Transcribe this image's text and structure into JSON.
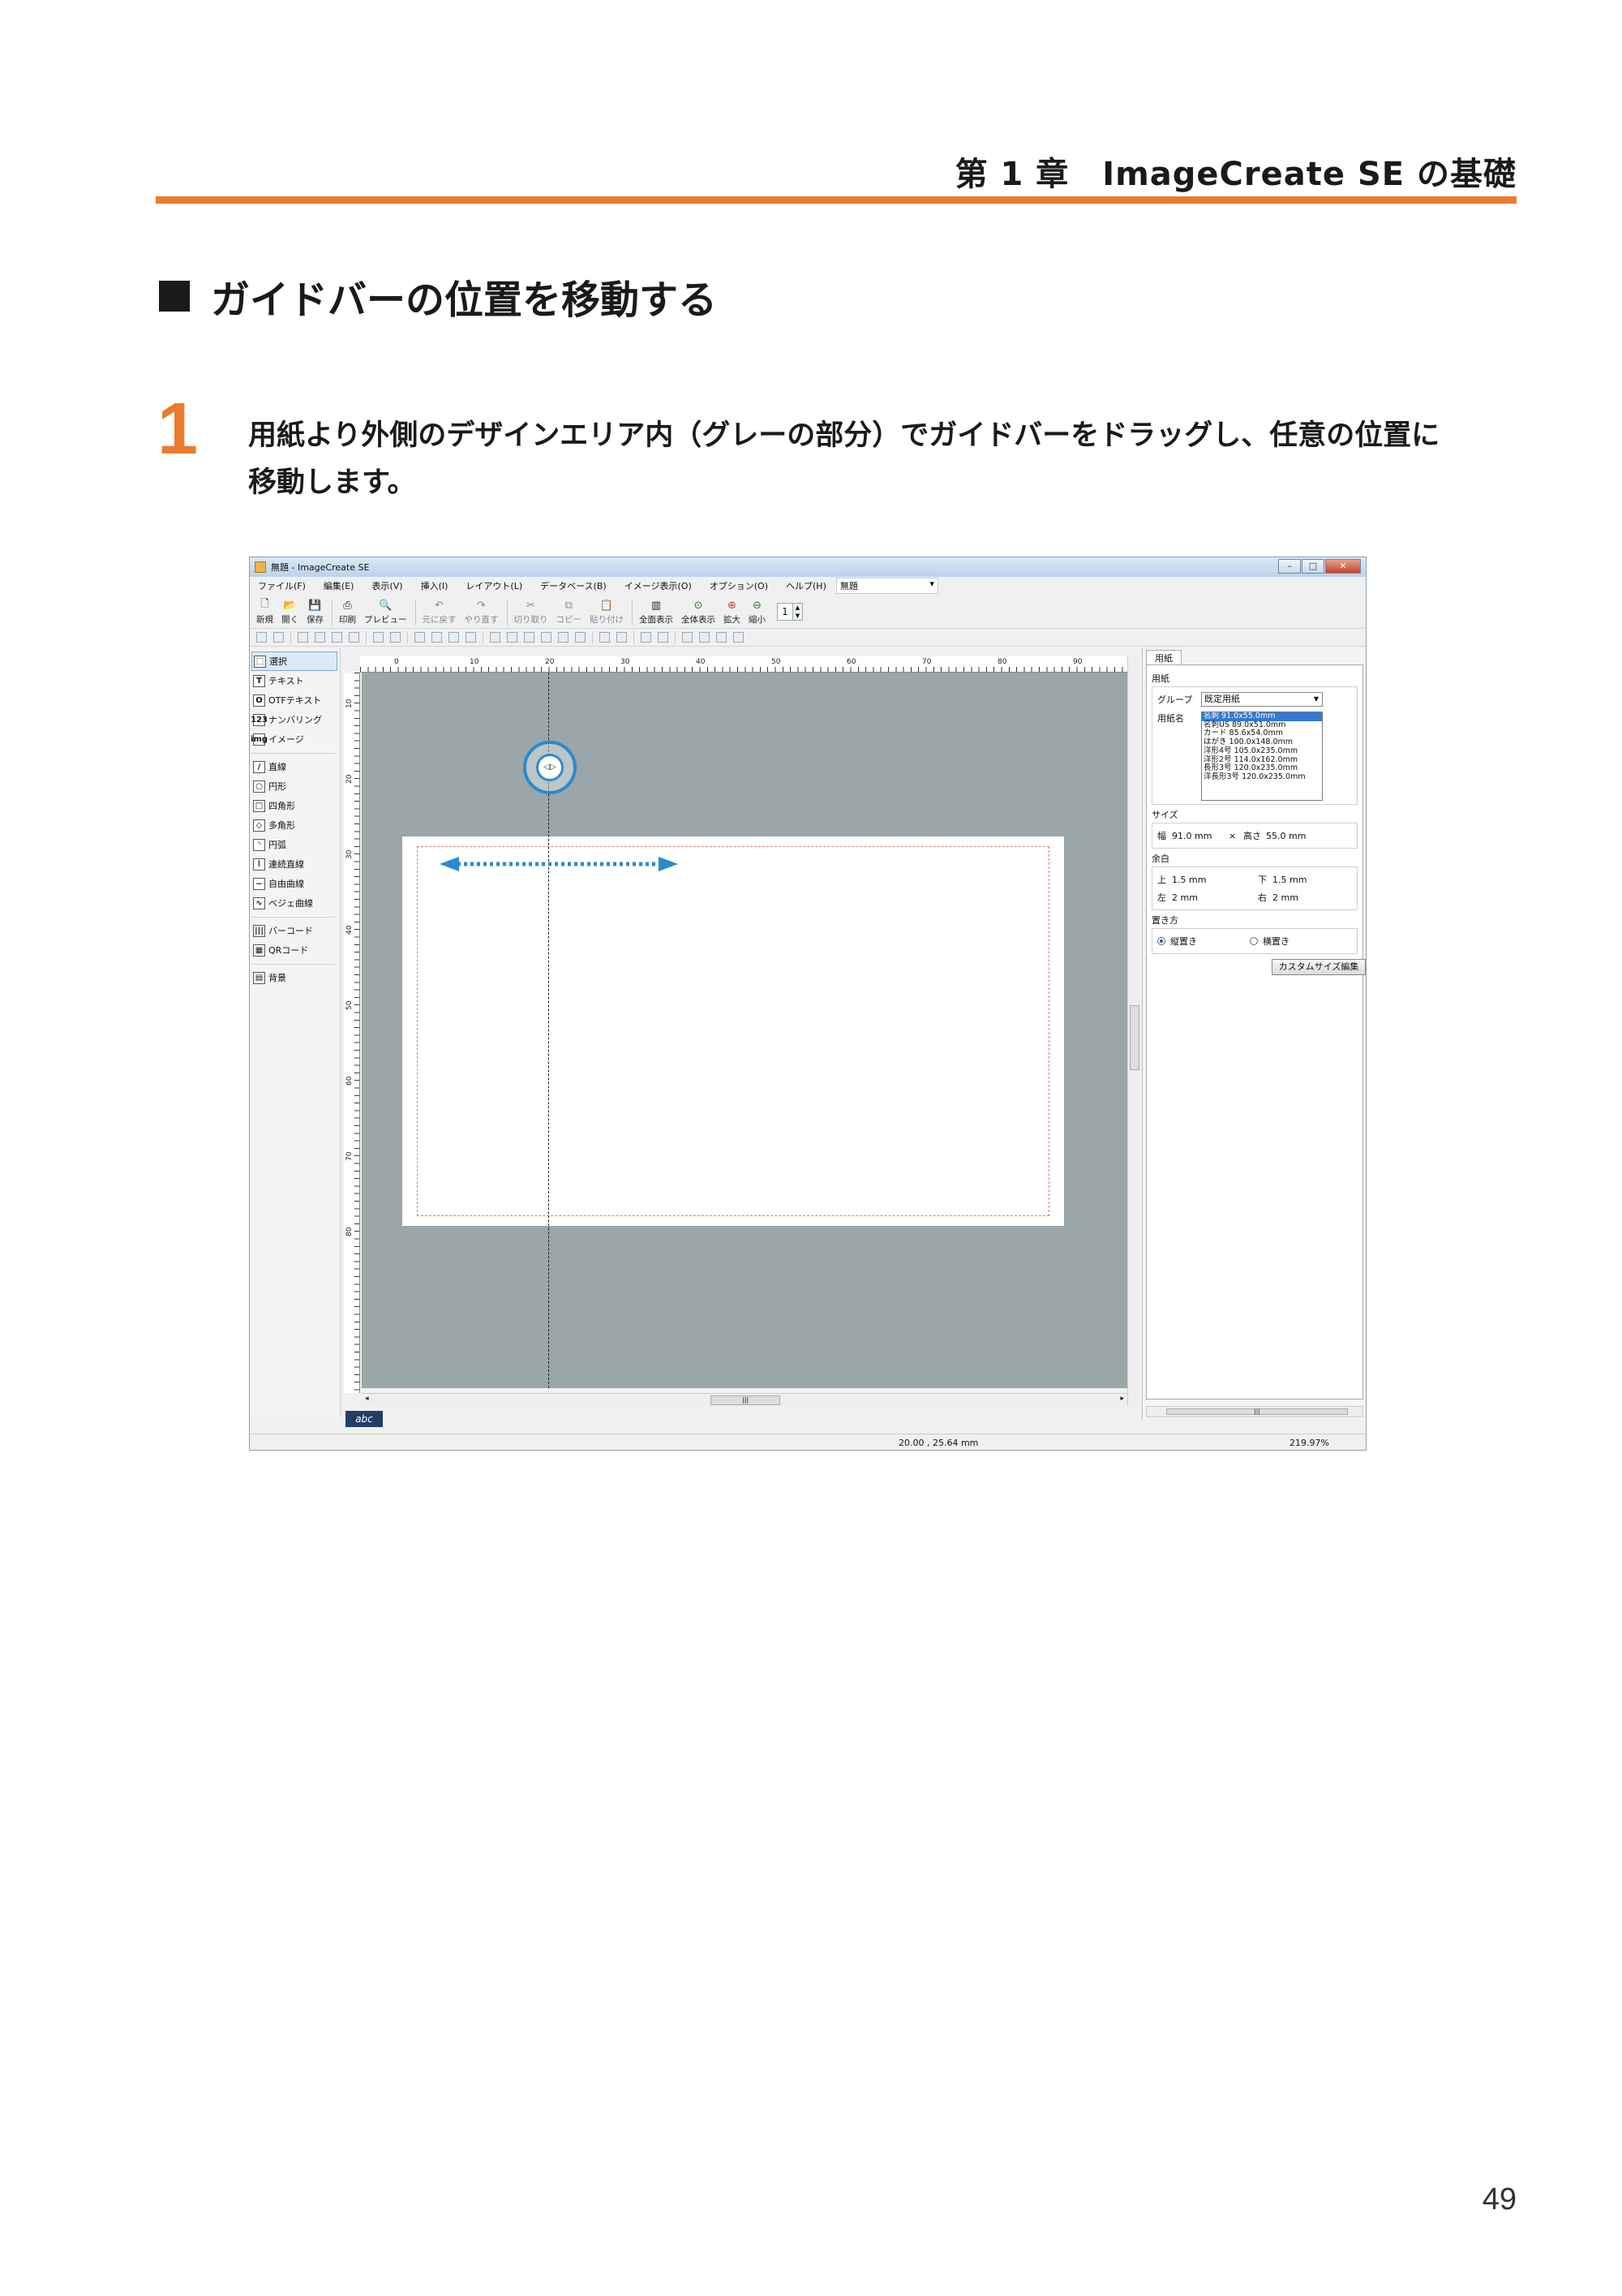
{
  "page": {
    "chapter_header": "第 1 章　ImageCreate SE の基礎",
    "section_title": "ガイドバーの位置を移動する",
    "step_number": "1",
    "step_text_line1": "用紙より外側のデザインエリア内（グレーの部分）でガイドバーをドラッグし、任意の位置に",
    "step_text_line2": "移動します。",
    "page_number": "49",
    "accent_color": "#ec7a2e"
  },
  "app": {
    "title": "無題 - ImageCreate SE",
    "menu": [
      "ファイル(F)",
      "編集(E)",
      "表示(V)",
      "挿入(I)",
      "レイアウト(L)",
      "データベース(B)",
      "イメージ表示(O)",
      "オプション(O)",
      "ヘルプ(H)"
    ],
    "document_select": "無題",
    "toolbar": [
      {
        "label": "新規",
        "icon": "new-document-icon"
      },
      {
        "label": "開く",
        "icon": "open-folder-icon"
      },
      {
        "label": "保存",
        "icon": "save-icon"
      },
      {
        "label": "印刷",
        "icon": "print-icon"
      },
      {
        "label": "プレビュー",
        "icon": "preview-icon"
      },
      {
        "label": "元に戻す",
        "icon": "undo-icon"
      },
      {
        "label": "やり直す",
        "icon": "redo-icon"
      },
      {
        "label": "切り取り",
        "icon": "cut-icon"
      },
      {
        "label": "コピー",
        "icon": "copy-icon"
      },
      {
        "label": "貼り付け",
        "icon": "paste-icon"
      },
      {
        "label": "全面表示",
        "icon": "full-view-icon"
      },
      {
        "label": "全体表示",
        "icon": "fit-view-icon"
      },
      {
        "label": "拡大",
        "icon": "zoom-in-icon"
      },
      {
        "label": "縮小",
        "icon": "zoom-out-icon"
      }
    ],
    "zoom_step": "1",
    "tools": [
      "選択",
      "テキスト",
      "OTFテキスト",
      "ナンバリング",
      "イメージ",
      "直線",
      "円形",
      "四角形",
      "多角形",
      "円弧",
      "連続直線",
      "自由曲線",
      "ベジェ曲線",
      "バーコード",
      "QRコード",
      "背景"
    ],
    "tool_icons": [
      "T",
      "O",
      "123",
      "img",
      "/",
      "○",
      "□",
      "◇",
      "◝",
      "⌇",
      "~",
      "∿",
      "|||",
      "▦",
      "▤"
    ],
    "ruler_top": [
      "0",
      "10",
      "20",
      "30",
      "40",
      "50",
      "60",
      "70",
      "80",
      "90"
    ],
    "ruler_left": [
      "10",
      "20",
      "30",
      "40",
      "50",
      "60",
      "70",
      "80"
    ],
    "abc_chip": "abc",
    "status_coords": "20.00 , 25.64 mm",
    "status_zoom": "219.97%",
    "props": {
      "tab": "用紙",
      "group_paper": "用紙",
      "group_label": "グループ",
      "group_value": "既定用紙",
      "paper_name_label": "用紙名",
      "paper_list": [
        "名刺 91.0x55.0mm",
        "名刺US 89.0x51.0mm",
        "カード 85.6x54.0mm",
        "はがき 100.0x148.0mm",
        "洋形4号 105.0x235.0mm",
        "洋形2号 114.0x162.0mm",
        "長形3号 120.0x235.0mm",
        "洋長形3号 120.0x235.0mm"
      ],
      "size_title": "サイズ",
      "width_label": "幅",
      "width_value": "91.0 mm",
      "times": "×",
      "height_label": "高さ",
      "height_value": "55.0 mm",
      "margin_title": "余白",
      "top_label": "上",
      "top_value": "1.5 mm",
      "bottom_label": "下",
      "bottom_value": "1.5 mm",
      "left_label": "左",
      "left_value": "2 mm",
      "right_label": "右",
      "right_value": "2 mm",
      "orientation_title": "置き方",
      "portrait": "縦置き",
      "landscape": "横置き",
      "custom_button": "カスタムサイズ編集"
    }
  }
}
